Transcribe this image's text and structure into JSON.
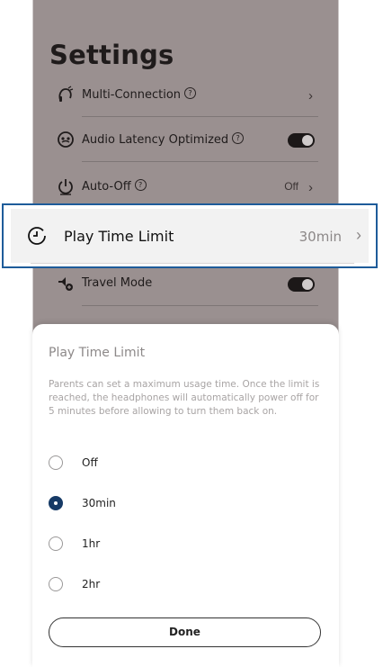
{
  "settings": {
    "title": "Settings",
    "items": [
      {
        "label": "Multi-Connection",
        "icon": "multi-connection-icon",
        "help": "?"
      },
      {
        "label": "Audio Latency Optimized",
        "icon": "latency-icon",
        "help": "?",
        "toggle": true
      },
      {
        "label": "Auto-Off",
        "icon": "power-icon",
        "help": "?",
        "value": "Off"
      },
      {
        "label": "Travel Mode",
        "icon": "travel-mode-icon",
        "toggle": true
      }
    ]
  },
  "highlight": {
    "label": "Play Time Limit",
    "value": "30min",
    "icon": "clock-icon"
  },
  "sheet": {
    "title": "Play Time Limit",
    "description": "Parents can set a maximum usage time. Once the limit is reached, the headphones will automatically power off for 5 minutes before allowing to turn them back on.",
    "options": [
      {
        "label": "Off",
        "selected": false
      },
      {
        "label": "30min",
        "selected": true
      },
      {
        "label": "1hr",
        "selected": false
      },
      {
        "label": "2hr",
        "selected": false
      }
    ],
    "done_label": "Done"
  },
  "colors": {
    "overlay": "#9a9090",
    "highlight_border": "#1e5c9a",
    "radio_selected": "#163a66"
  }
}
